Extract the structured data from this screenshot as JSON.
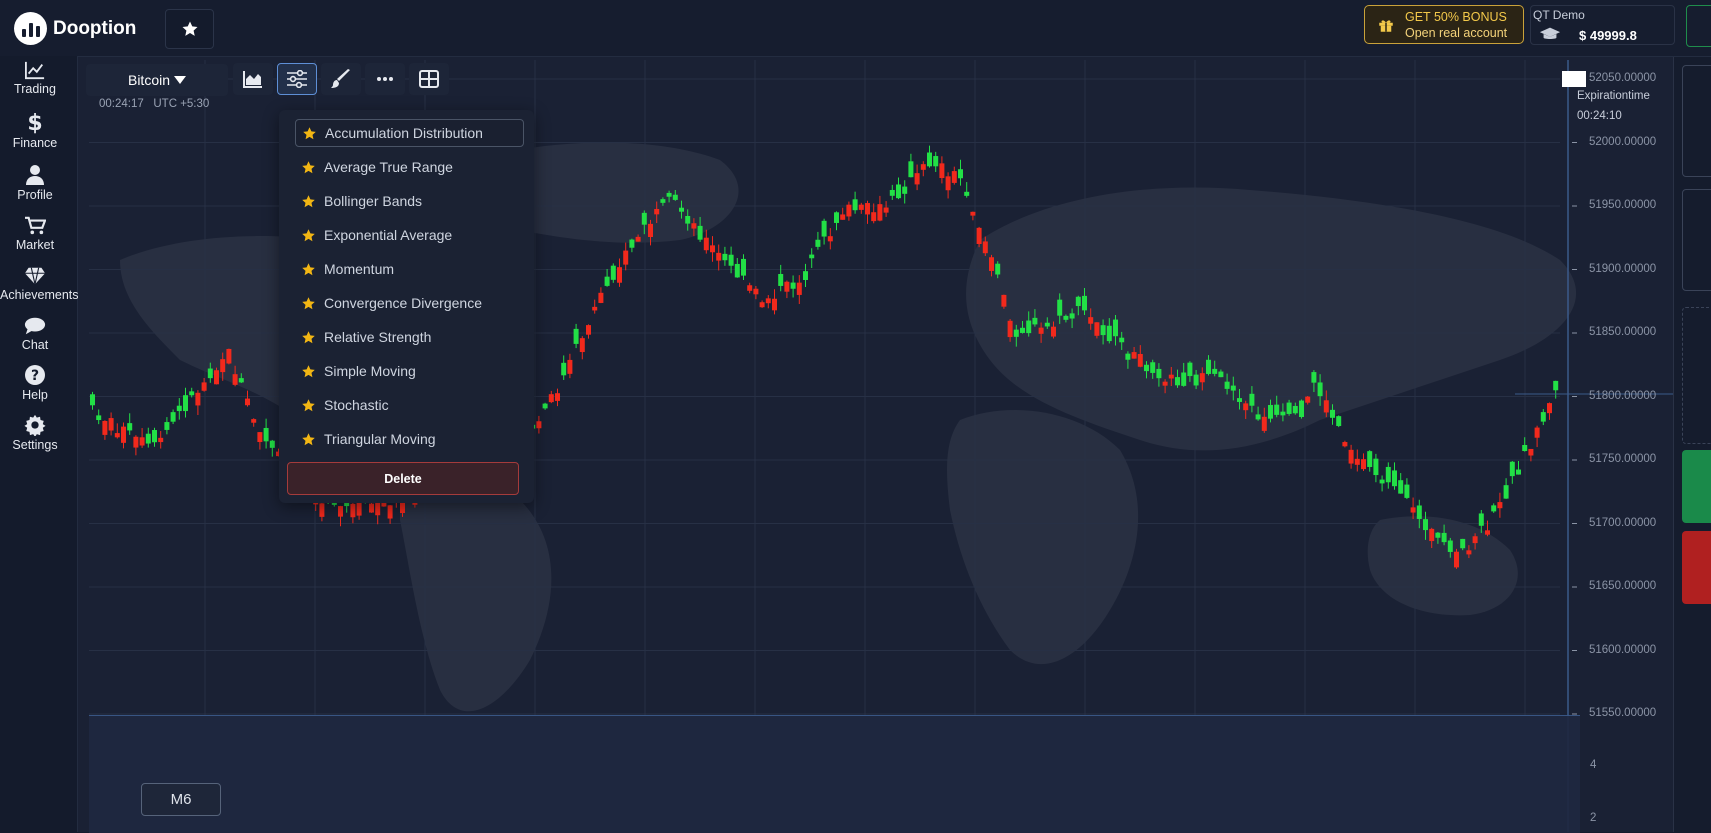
{
  "brand": {
    "name": "Dooption"
  },
  "header": {
    "bonus_line1": "GET 50% BONUS",
    "bonus_line2": "Open real account",
    "account_type": "QT Demo",
    "balance": "$ 49999.8"
  },
  "sidebar": {
    "items": [
      {
        "label": "Trading",
        "icon": "chart-line-icon"
      },
      {
        "label": "Finance",
        "icon": "dollar-icon"
      },
      {
        "label": "Profile",
        "icon": "user-icon"
      },
      {
        "label": "Market",
        "icon": "cart-icon"
      },
      {
        "label": "Achievements",
        "icon": "diamond-icon"
      },
      {
        "label": "Chat",
        "icon": "chat-bubble-icon"
      },
      {
        "label": "Help",
        "icon": "question-icon"
      },
      {
        "label": "Settings",
        "icon": "gear-icon"
      }
    ]
  },
  "chart": {
    "asset": "Bitcoin",
    "time": "00:24:17",
    "timezone": "UTC +5:30",
    "timeframe": "M6",
    "expiration_label": "Expirationtime",
    "expiration_time": "00:24:10",
    "price_labels": [
      "52050.00000",
      "52000.00000",
      "51950.00000",
      "51900.00000",
      "51850.00000",
      "51800.00000",
      "51750.00000",
      "51700.00000",
      "51650.00000",
      "51600.00000",
      "51550.00000"
    ],
    "volume_labels": [
      "4",
      "2"
    ],
    "colors": {
      "up": "#22e046",
      "down": "#f2291c",
      "background": "#1a2134"
    }
  },
  "indicators_menu": {
    "items": [
      "Accumulation Distribution",
      "Average True Range",
      "Bollinger Bands",
      "Exponential Average",
      "Momentum",
      "Convergence Divergence",
      "Relative Strength",
      "Simple Moving",
      "Stochastic",
      "Triangular Moving"
    ],
    "selected": "Accumulation Distribution",
    "delete_label": "Delete"
  }
}
